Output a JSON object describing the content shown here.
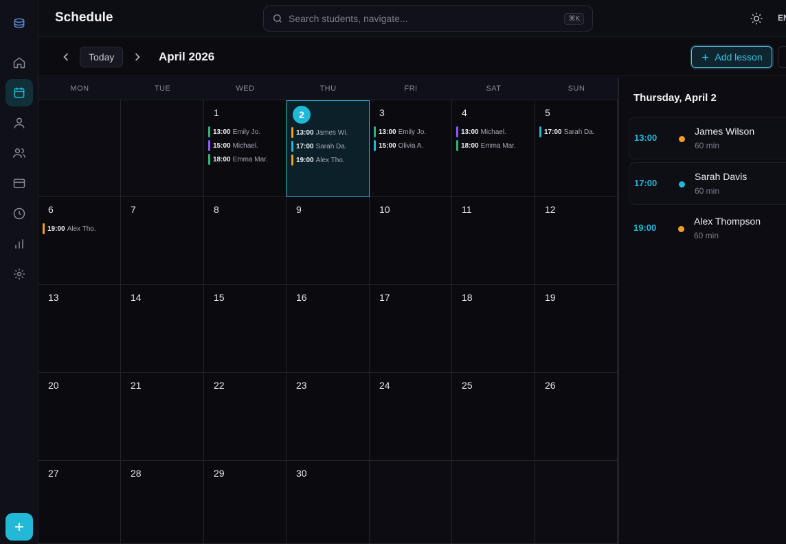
{
  "header": {
    "title": "Schedule",
    "search_placeholder": "Search students, navigate...",
    "shortcut": "⌘K",
    "language": "EN"
  },
  "sidebar": {
    "items": [
      {
        "name": "home",
        "icon": "home-icon"
      },
      {
        "name": "calendar",
        "icon": "calendar-icon",
        "active": true
      },
      {
        "name": "student",
        "icon": "user-icon"
      },
      {
        "name": "groups",
        "icon": "users-icon"
      },
      {
        "name": "payments",
        "icon": "card-icon"
      },
      {
        "name": "history",
        "icon": "clock-icon"
      },
      {
        "name": "reports",
        "icon": "chart-icon"
      },
      {
        "name": "settings",
        "icon": "gear-icon"
      }
    ]
  },
  "toolbar": {
    "today_label": "Today",
    "month_title": "April 2026",
    "add_lesson_label": "Add lesson"
  },
  "calendar": {
    "weekdays": [
      "MON",
      "TUE",
      "WED",
      "THU",
      "FRI",
      "SAT",
      "SUN"
    ],
    "weeks": [
      [
        {
          "day": "",
          "events": []
        },
        {
          "day": "",
          "events": []
        },
        {
          "day": "1",
          "events": [
            {
              "time": "13:00",
              "name": "Emily Jo.",
              "color": "#2fb57c"
            },
            {
              "time": "15:00",
              "name": "Michael.",
              "color": "#8b5cf6"
            },
            {
              "time": "18:00",
              "name": "Emma Mar.",
              "color": "#2fb57c"
            }
          ]
        },
        {
          "day": "2",
          "today": true,
          "events": [
            {
              "time": "13:00",
              "name": "James Wi.",
              "color": "#f0a020"
            },
            {
              "time": "17:00",
              "name": "Sarah Da.",
              "color": "#22b8d8"
            },
            {
              "time": "19:00",
              "name": "Alex Tho.",
              "color": "#f0a020"
            }
          ]
        },
        {
          "day": "3",
          "events": [
            {
              "time": "13:00",
              "name": "Emily Jo.",
              "color": "#2fb57c"
            },
            {
              "time": "15:00",
              "name": "Olivia A.",
              "color": "#22b8d8"
            }
          ]
        },
        {
          "day": "4",
          "events": [
            {
              "time": "13:00",
              "name": "Michael.",
              "color": "#8b5cf6"
            },
            {
              "time": "18:00",
              "name": "Emma Mar.",
              "color": "#2fb57c"
            }
          ]
        },
        {
          "day": "5",
          "events": [
            {
              "time": "17:00",
              "name": "Sarah Da.",
              "color": "#22b8d8"
            }
          ]
        }
      ],
      [
        {
          "day": "6",
          "events": [
            {
              "time": "19:00",
              "name": "Alex Tho.",
              "color": "#f0a020"
            }
          ]
        },
        {
          "day": "7",
          "events": []
        },
        {
          "day": "8",
          "events": []
        },
        {
          "day": "9",
          "events": []
        },
        {
          "day": "10",
          "events": []
        },
        {
          "day": "11",
          "events": []
        },
        {
          "day": "12",
          "events": []
        }
      ],
      [
        {
          "day": "13",
          "events": []
        },
        {
          "day": "14",
          "events": []
        },
        {
          "day": "15",
          "events": []
        },
        {
          "day": "16",
          "events": []
        },
        {
          "day": "17",
          "events": []
        },
        {
          "day": "18",
          "events": []
        },
        {
          "day": "19",
          "events": []
        }
      ],
      [
        {
          "day": "20",
          "events": []
        },
        {
          "day": "21",
          "events": []
        },
        {
          "day": "22",
          "events": []
        },
        {
          "day": "23",
          "events": []
        },
        {
          "day": "24",
          "events": []
        },
        {
          "day": "25",
          "events": []
        },
        {
          "day": "26",
          "events": []
        }
      ],
      [
        {
          "day": "27",
          "events": []
        },
        {
          "day": "28",
          "events": []
        },
        {
          "day": "29",
          "events": []
        },
        {
          "day": "30",
          "events": []
        },
        {
          "day": "",
          "events": []
        },
        {
          "day": "",
          "events": []
        },
        {
          "day": "",
          "events": []
        }
      ]
    ]
  },
  "panel": {
    "title": "Thursday, April 2",
    "lessons": [
      {
        "time": "13:00",
        "name": "James Wilson",
        "duration": "60 min",
        "color": "#f0a020"
      },
      {
        "time": "17:00",
        "name": "Sarah Davis",
        "duration": "60 min",
        "color": "#22b8d8"
      },
      {
        "time": "19:00",
        "name": "Alex Thompson",
        "duration": "60 min",
        "color": "#f0a020"
      }
    ]
  }
}
